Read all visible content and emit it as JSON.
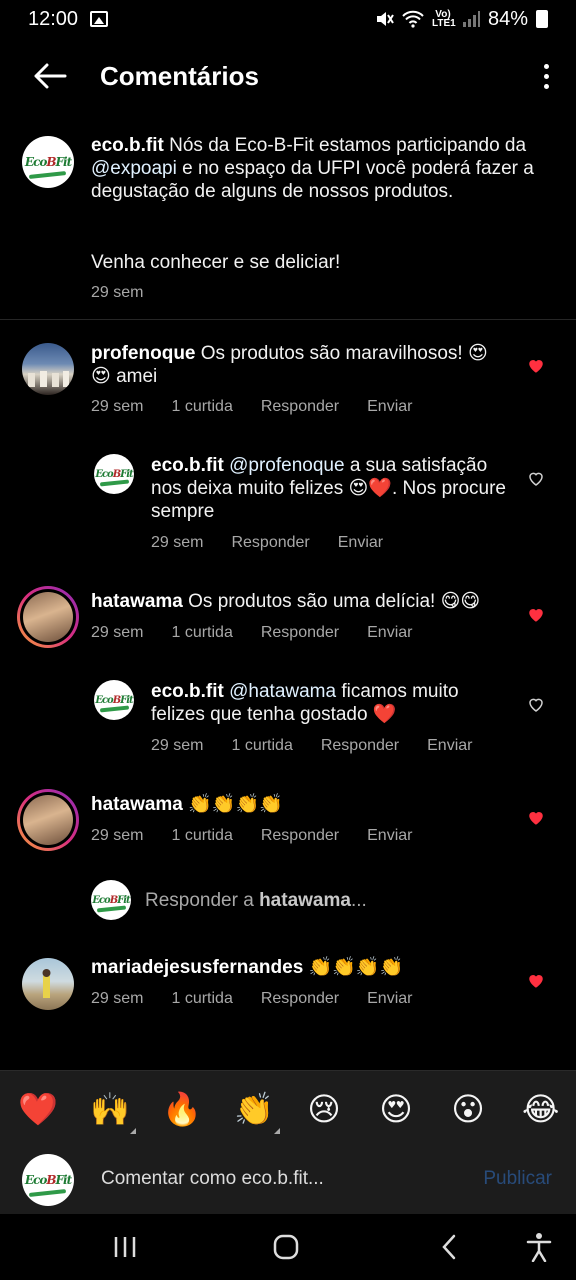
{
  "status_bar": {
    "time": "12:00",
    "network": "Vo) LTE1",
    "battery": "84%"
  },
  "header": {
    "title": "Comentários"
  },
  "caption": {
    "user": "eco.b.fit",
    "text_before": " Nós da Eco-B-Fit estamos participando da ",
    "mention": "@expoapi",
    "text_after": " e no espaço da UFPI você poderá fazer a degustação de alguns de nossos produtos.",
    "line2": "Venha conhecer e se deliciar!",
    "time": "29 sem"
  },
  "avatars": {
    "eco_logo_text": "EcoBFit"
  },
  "comments": [
    {
      "user": "profenoque",
      "text": " Os produtos são maravilhosos! 😍",
      "text2": "😍 amei",
      "time": "29 sem",
      "likes": "1 curtida",
      "reply": "Responder",
      "send": "Enviar",
      "liked": true
    },
    {
      "user": "eco.b.fit",
      "mention": "@profenoque",
      "text": " a sua satisfação nos deixa muito felizes 😍❤️. Nos procure sempre",
      "time": "29 sem",
      "reply": "Responder",
      "send": "Enviar",
      "liked": false
    },
    {
      "user": "hatawama",
      "text": " Os produtos são uma delícia! 😋😋",
      "time": "29 sem",
      "likes": "1 curtida",
      "reply": "Responder",
      "send": "Enviar",
      "liked": true
    },
    {
      "user": "eco.b.fit",
      "mention": "@hatawama",
      "text": " ficamos muito felizes que tenha gostado ❤️",
      "time": "29 sem",
      "likes": "1 curtida",
      "reply": "Responder",
      "send": "Enviar",
      "liked": false
    },
    {
      "user": "hatawama",
      "text": " 👏👏👏👏",
      "time": "29 sem",
      "likes": "1 curtida",
      "reply": "Responder",
      "send": "Enviar",
      "liked": true
    },
    {
      "user": "mariadejesusfernandes",
      "text": " 👏👏👏👏",
      "time": "29 sem",
      "likes": "1 curtida",
      "reply": "Responder",
      "send": "Enviar",
      "liked": true
    }
  ],
  "reply_prompt": {
    "prefix": "Responder a ",
    "user": "hatawama",
    "suffix": "..."
  },
  "emoji_bar": [
    "❤️",
    "🙌",
    "🔥",
    "👏",
    "😢",
    "😍",
    "😮",
    "😂"
  ],
  "composer": {
    "placeholder": "Comentar como eco.b.fit...",
    "publish": "Publicar"
  },
  "colors": {
    "like_red": "#ff3040",
    "link_blue_disabled": "#284b7a",
    "muted": "#a8a8a8"
  }
}
